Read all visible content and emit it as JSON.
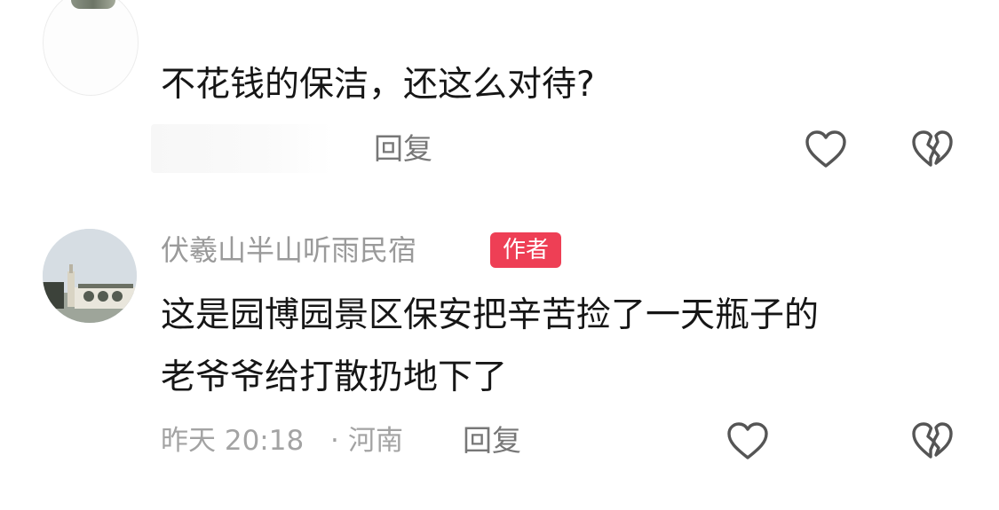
{
  "comments": [
    {
      "text": "不花钱的保洁，还这么对待?",
      "reply_label": "回复",
      "like_icon": "heart-outline-icon",
      "dislike_icon": "broken-heart-icon"
    },
    {
      "username": "伏羲山半山听雨民宿",
      "badge": "作者",
      "text_line1": "这是园博园景区保安把辛苦捡了一天瓶子的",
      "text_line2": "老爷爷给打散扔地下了",
      "time": "昨天 20:18",
      "separator": "·",
      "location": "河南",
      "reply_label": "回复",
      "like_icon": "heart-outline-icon",
      "dislike_icon": "broken-heart-icon"
    }
  ],
  "colors": {
    "badge_bg": "#ee3f55",
    "meta_text": "#a3a3a3",
    "icon_stroke": "#555555"
  }
}
